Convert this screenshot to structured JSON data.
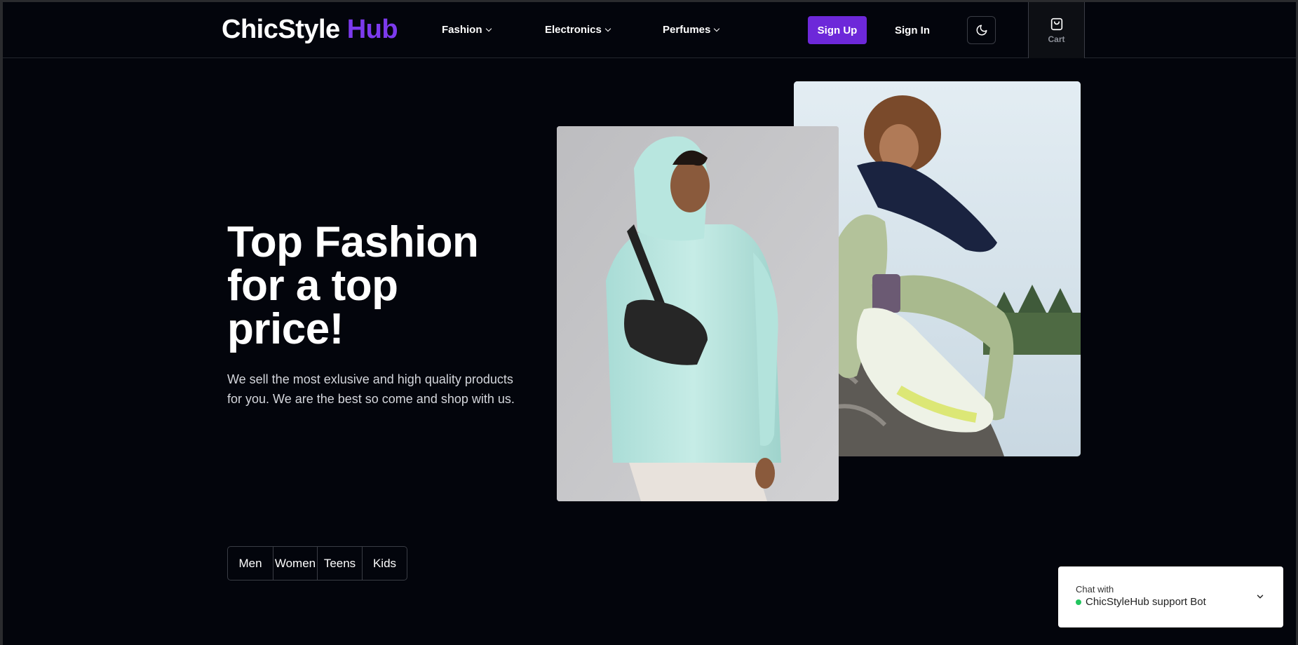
{
  "brand": {
    "name_part1": "ChicStyle",
    "name_part2": "Hub",
    "accent_color": "#7c3aed"
  },
  "nav": {
    "items": [
      {
        "label": "Fashion",
        "icon": "chevron-down-icon"
      },
      {
        "label": "Electronics",
        "icon": "chevron-down-icon"
      },
      {
        "label": "Perfumes",
        "icon": "chevron-down-icon"
      }
    ],
    "signup_label": "Sign Up",
    "signin_label": "Sign In",
    "theme_icon": "moon-icon",
    "cart_label": "Cart",
    "cart_icon": "shopping-bag-icon"
  },
  "hero": {
    "title": "Top Fashion for a top price!",
    "subtitle": "We sell the most exlusive and high quality products for you. We are the best so come and shop with us."
  },
  "categories": [
    "Men",
    "Women",
    "Teens",
    "Kids"
  ],
  "chat": {
    "label": "Chat with",
    "bot_name": "ChicStyleHub support Bot",
    "status_color": "#22c55e"
  }
}
